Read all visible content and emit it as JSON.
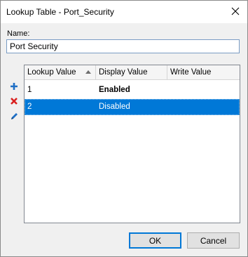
{
  "window": {
    "title": "Lookup Table - Port_Security",
    "close_icon": "close-icon"
  },
  "form": {
    "name_label": "Name:",
    "name_value": "Port Security"
  },
  "toolbar": {
    "add_icon": "plus-icon",
    "delete_icon": "x-icon",
    "edit_icon": "pencil-icon",
    "colors": {
      "add": "#1f6fc5",
      "delete": "#d9201f",
      "edit": "#1f6fc5"
    }
  },
  "table": {
    "columns": [
      "Lookup Value",
      "Display Value",
      "Write Value"
    ],
    "sorted_column": "Lookup Value",
    "sort_direction": "ascending",
    "rows": [
      {
        "lookup": "1",
        "display": "Enabled",
        "write": "",
        "selected": false
      },
      {
        "lookup": "2",
        "display": "Disabled",
        "write": "",
        "selected": true
      }
    ],
    "selection_color": "#0078d7"
  },
  "buttons": {
    "ok": "OK",
    "cancel": "Cancel"
  }
}
